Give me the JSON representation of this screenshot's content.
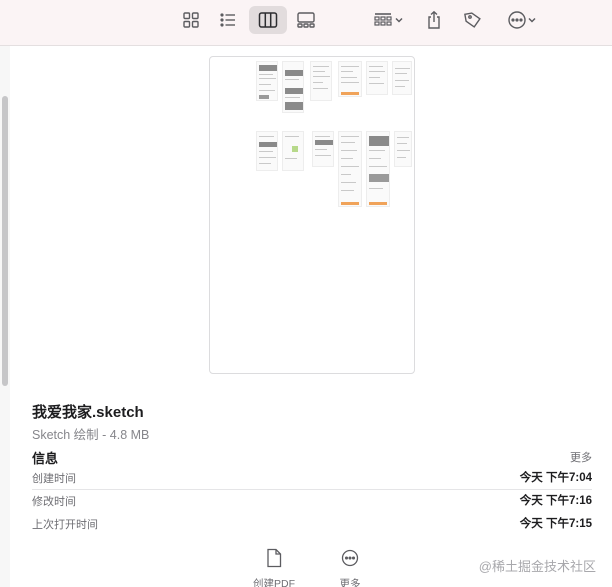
{
  "toolbar": {
    "icons": [
      "icon-view-grid-icon",
      "list-view-icon",
      "column-view-icon",
      "gallery-view-icon",
      "group-by-icon",
      "share-icon",
      "tag-icon",
      "more-actions-icon"
    ]
  },
  "file": {
    "name": "我爱我家.sketch",
    "subtitle": "Sketch 绘制 - 4.8 MB"
  },
  "info": {
    "heading": "信息",
    "more_label": "更多",
    "rows": [
      {
        "label": "创建时间",
        "value": "今天 下午7:04"
      },
      {
        "label": "修改时间",
        "value": "今天 下午7:16"
      },
      {
        "label": "上次打开时间",
        "value": "今天 下午7:15"
      }
    ]
  },
  "actions": [
    {
      "label": "创建PDF",
      "icon": "document-icon"
    },
    {
      "label": "更多",
      "icon": "ellipsis-circle-icon"
    }
  ],
  "watermark": "@稀土掘金技术社区",
  "colors": {
    "toolbar_bg": "#fbf4f5",
    "accent_orange": "#f0a35a"
  }
}
